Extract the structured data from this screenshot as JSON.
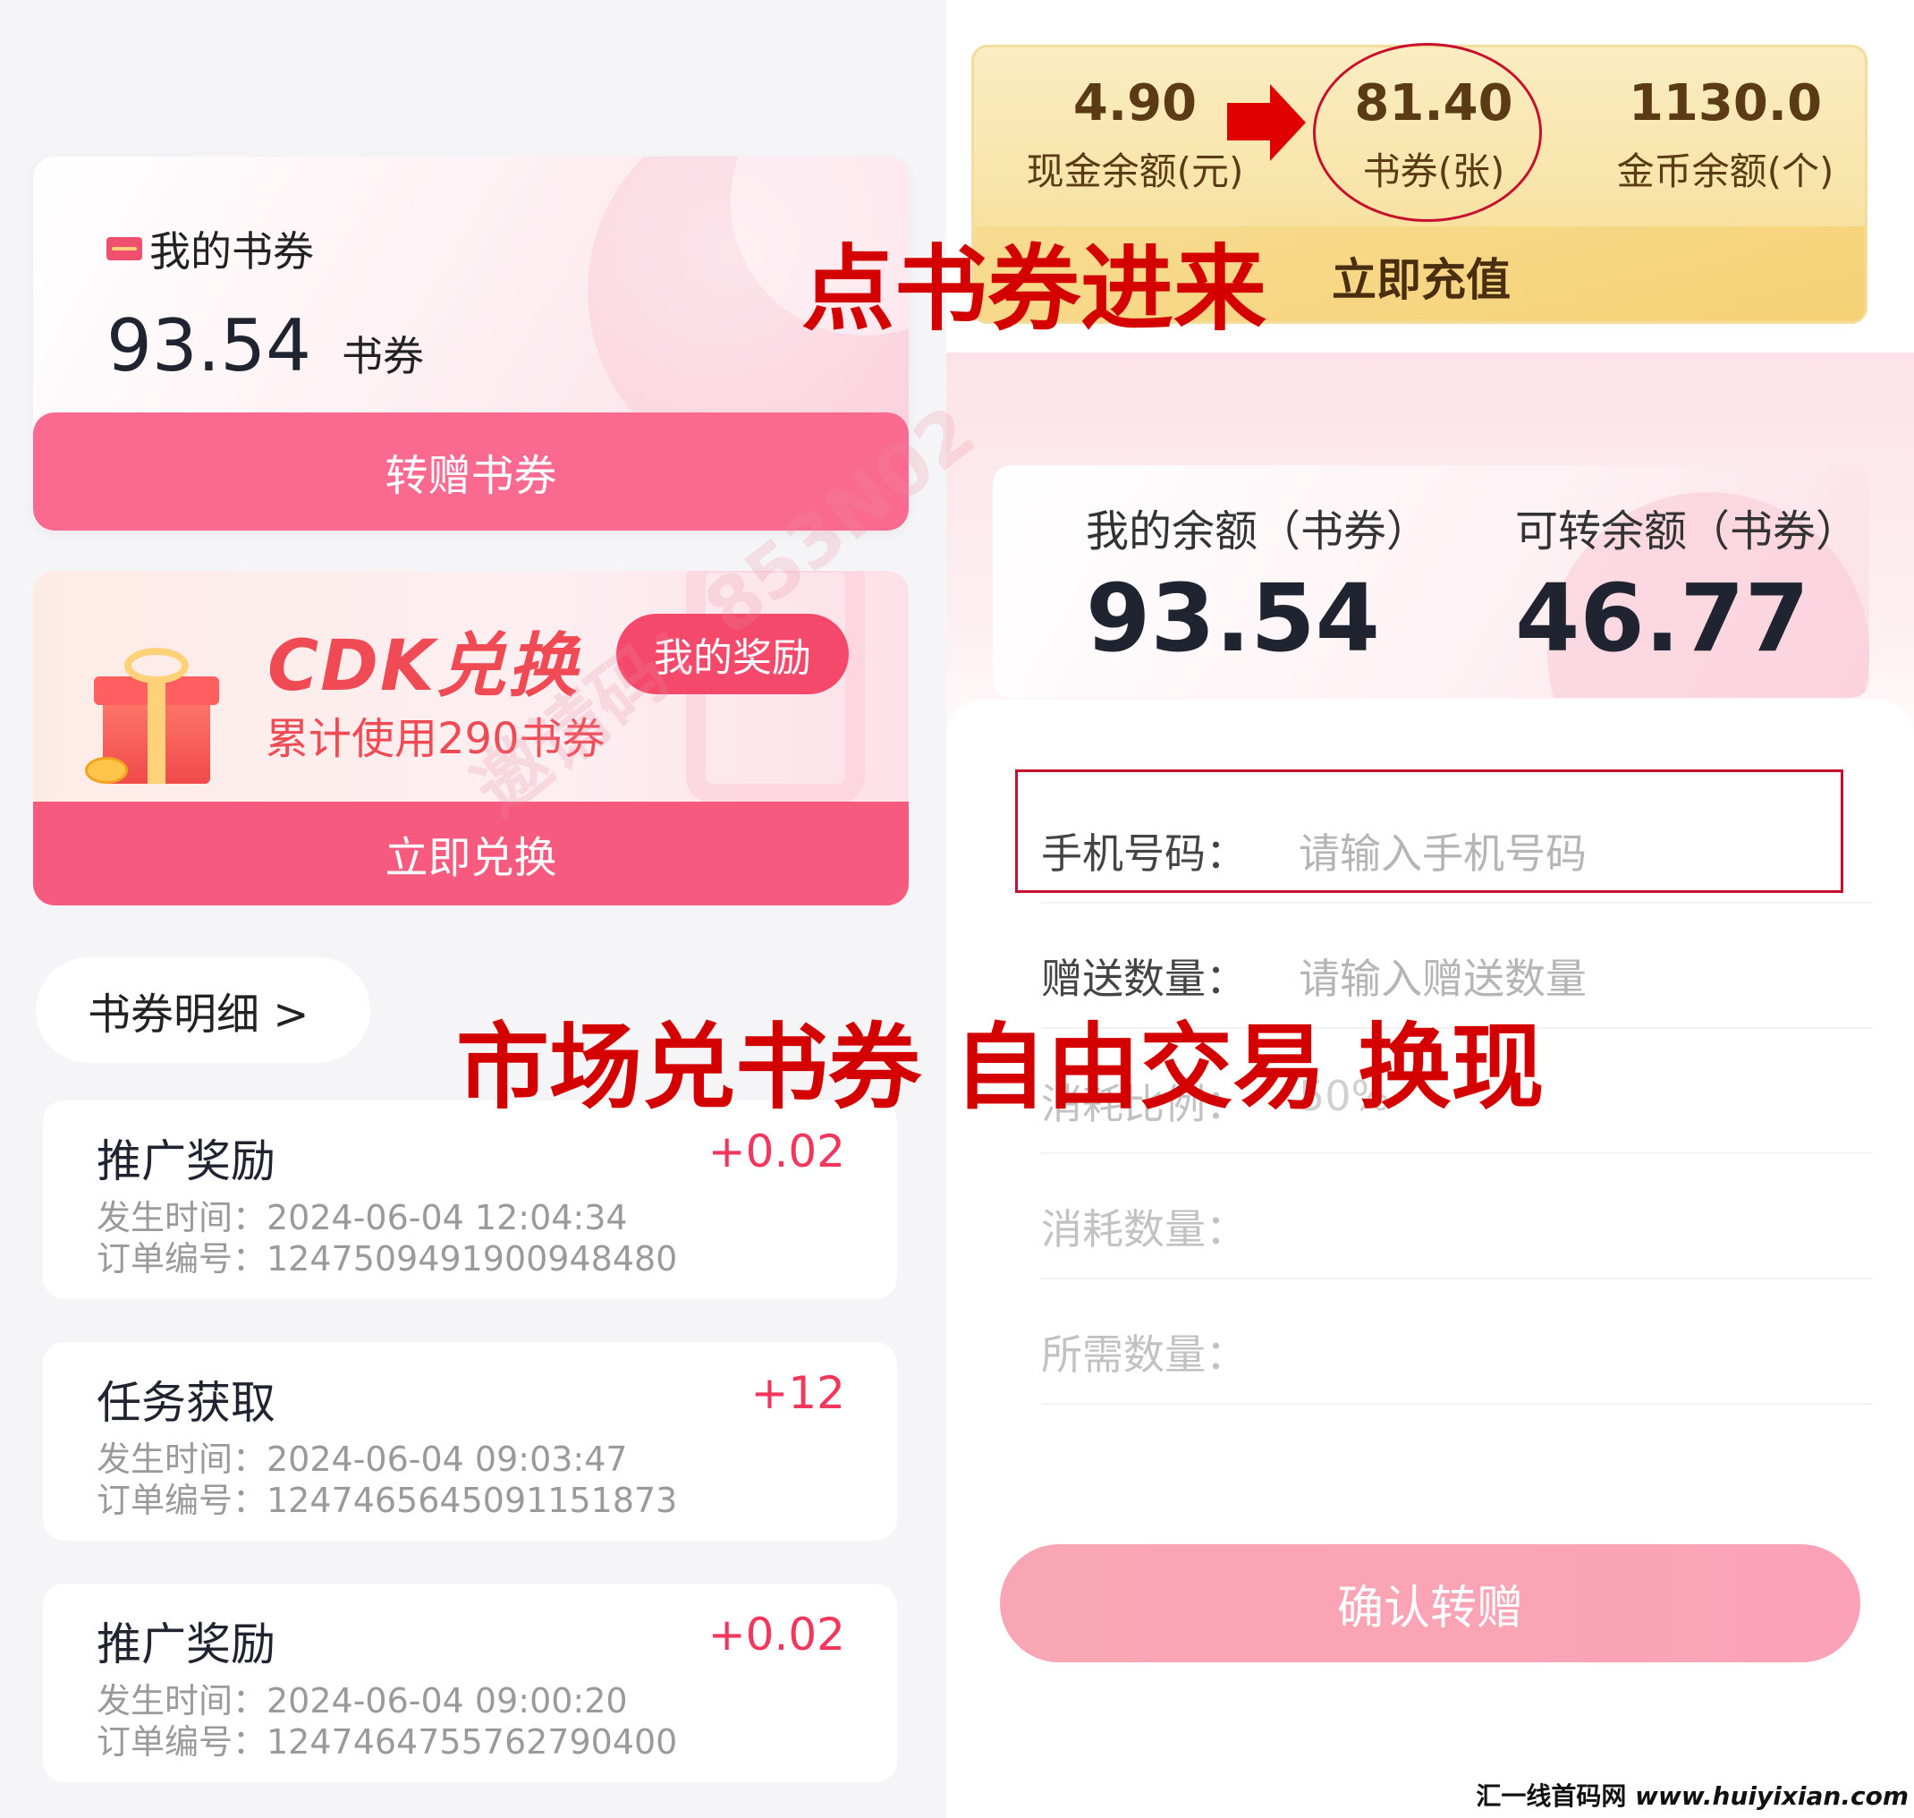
{
  "left": {
    "coupon_card": {
      "title": "我的书券",
      "amount": "93.54",
      "unit": "书券",
      "transfer_button": "转赠书券"
    },
    "cdk_card": {
      "title": "CDK兑换",
      "reward_button": "我的奖励",
      "subtitle": "累计使用290书券",
      "redeem_button": "立即兑换"
    },
    "detail_link": "书券明细 >",
    "records": [
      {
        "title": "推广奖励",
        "amount": "+0.02",
        "time": "发生时间：2024-06-04 12:04:34",
        "order": "订单编号：1247509491900948480"
      },
      {
        "title": "任务获取",
        "amount": "+12",
        "time": "发生时间：2024-06-04 09:03:47",
        "order": "订单编号：1247465645091151873"
      },
      {
        "title": "推广奖励",
        "amount": "+0.02",
        "time": "发生时间：2024-06-04 09:00:20",
        "order": "订单编号：1247464755762790400"
      }
    ]
  },
  "wallet": {
    "cash_value": "4.90",
    "cash_label": "现金余额(元)",
    "coupon_value": "81.40",
    "coupon_label": "书券(张)",
    "gold_value": "1130.0",
    "gold_label": "金币余额(个)",
    "recharge": "立即充值"
  },
  "transfer": {
    "my_balance_label": "我的余额（书券）",
    "my_balance": "93.54",
    "transferable_label": "可转余额（书券）",
    "transferable": "46.77",
    "fields": [
      {
        "label": "手机号码：",
        "value": "请输入手机号码"
      },
      {
        "label": "赠送数量：",
        "value": "请输入赠送数量"
      },
      {
        "label": "消耗比例：",
        "value": "50%"
      },
      {
        "label": "消耗数量：",
        "value": ""
      },
      {
        "label": "所需数量：",
        "value": ""
      }
    ],
    "confirm_button": "确认转赠"
  },
  "overlay": {
    "enter_text": "点书券进来",
    "market_text": "市场兑书券 自由交易 换现",
    "watermark": "邀请码：853N02",
    "footer_cn": "汇一线首码网",
    "footer_url": "www.huiyixian.com"
  },
  "colors": {
    "accent_pink": "#fa6a90",
    "overlay_red": "#d40000",
    "gold_text": "#5b3b16"
  }
}
